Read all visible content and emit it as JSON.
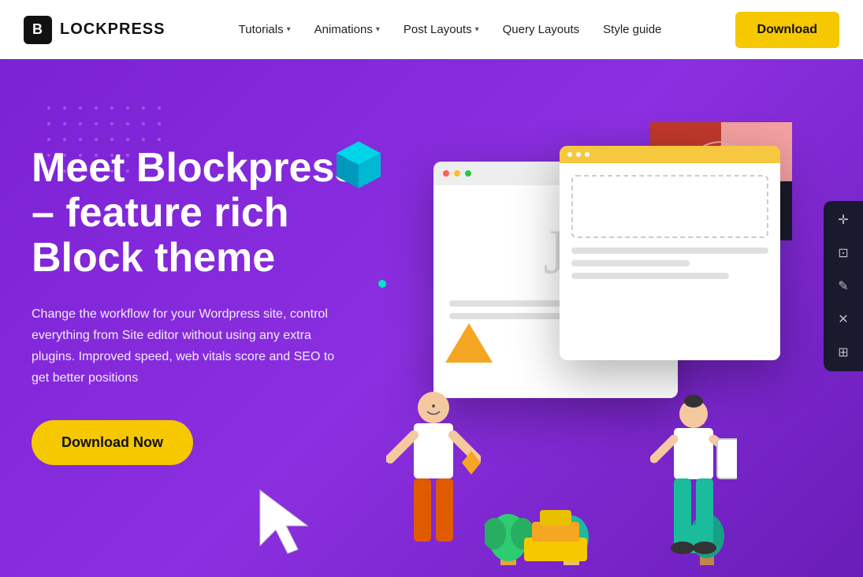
{
  "nav": {
    "logo_letter": "B",
    "logo_text": "LOCKPRESS",
    "links": [
      {
        "label": "Tutorials",
        "has_dropdown": true
      },
      {
        "label": "Animations",
        "has_dropdown": true
      },
      {
        "label": "Post Layouts",
        "has_dropdown": true
      },
      {
        "label": "Query Layouts",
        "has_dropdown": false
      },
      {
        "label": "Style guide",
        "has_dropdown": false
      }
    ],
    "download_btn": "Download"
  },
  "hero": {
    "title_line1": "Meet Blockpress",
    "title_line2": "– feature rich",
    "title_line3": "Block theme",
    "description": "Change the workflow for your Wordpress site, control everything from Site editor without using any extra plugins. Improved speed, web vitals score and SEO to get better positions",
    "cta_btn": "Download Now"
  },
  "toolbar": {
    "icons": [
      "✛",
      "⊡",
      "✕",
      "✎",
      "⊞"
    ]
  },
  "colors": {
    "hero_bg": "#7B22D4",
    "cta_bg": "#F5C800",
    "nav_bg": "#ffffff",
    "download_btn_bg": "#F5C800"
  }
}
